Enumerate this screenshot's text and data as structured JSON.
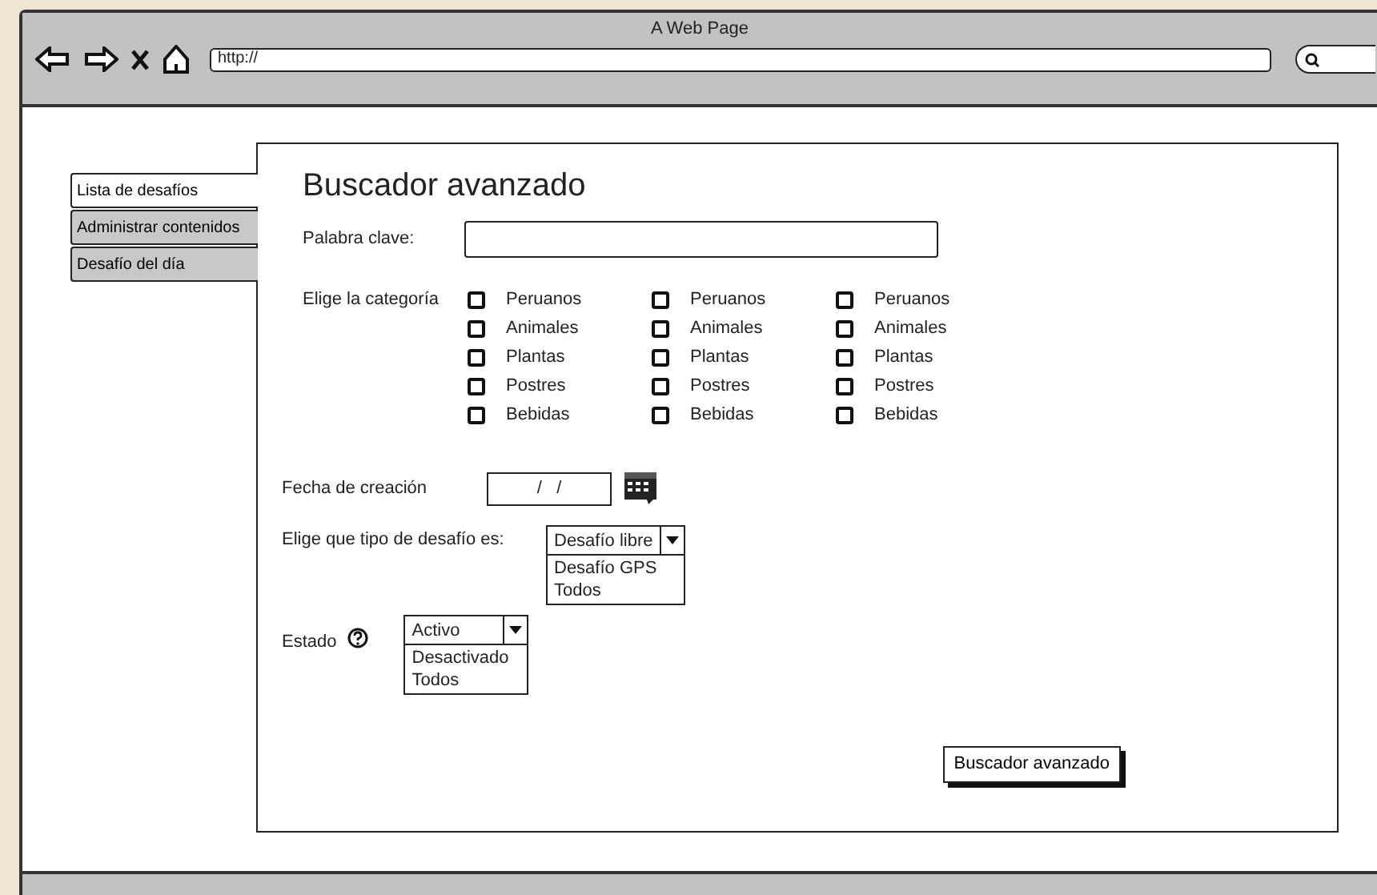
{
  "window": {
    "title": "A Web Page"
  },
  "address_bar": {
    "value": "http://"
  },
  "sidebar": {
    "tabs": [
      {
        "label": "Lista de desafíos",
        "selected": true
      },
      {
        "label": "Administrar contenidos",
        "selected": false
      },
      {
        "label": "Desafío del día",
        "selected": false
      }
    ]
  },
  "form": {
    "title": "Buscador avanzado",
    "keyword": {
      "label": "Palabra clave:"
    },
    "category": {
      "label": "Elige la categoría",
      "columns": [
        [
          {
            "label": "Peruanos",
            "checked": false
          },
          {
            "label": "Animales",
            "checked": false
          },
          {
            "label": "Plantas",
            "checked": false
          },
          {
            "label": "Postres",
            "checked": false
          },
          {
            "label": "Bebidas",
            "checked": false
          }
        ],
        [
          {
            "label": "Peruanos",
            "checked": false
          },
          {
            "label": "Animales",
            "checked": false
          },
          {
            "label": "Plantas",
            "checked": false
          },
          {
            "label": "Postres",
            "checked": false
          },
          {
            "label": "Bebidas",
            "checked": false
          }
        ],
        [
          {
            "label": "Peruanos",
            "checked": false
          },
          {
            "label": "Animales",
            "checked": false
          },
          {
            "label": "Plantas",
            "checked": false
          },
          {
            "label": "Postres",
            "checked": false
          },
          {
            "label": "Bebidas",
            "checked": false
          }
        ]
      ]
    },
    "date": {
      "label": "Fecha de creación",
      "value": "/   /"
    },
    "type": {
      "label": "Elige que tipo de desafío es:",
      "value": "Desafío libre",
      "expanded": true,
      "options": [
        "Desafío GPS",
        "Todos"
      ]
    },
    "status": {
      "label": "Estado",
      "value": "Activo",
      "expanded": true,
      "options": [
        "Desactivado",
        "Todos"
      ]
    },
    "submit": "Buscador avanzado"
  }
}
